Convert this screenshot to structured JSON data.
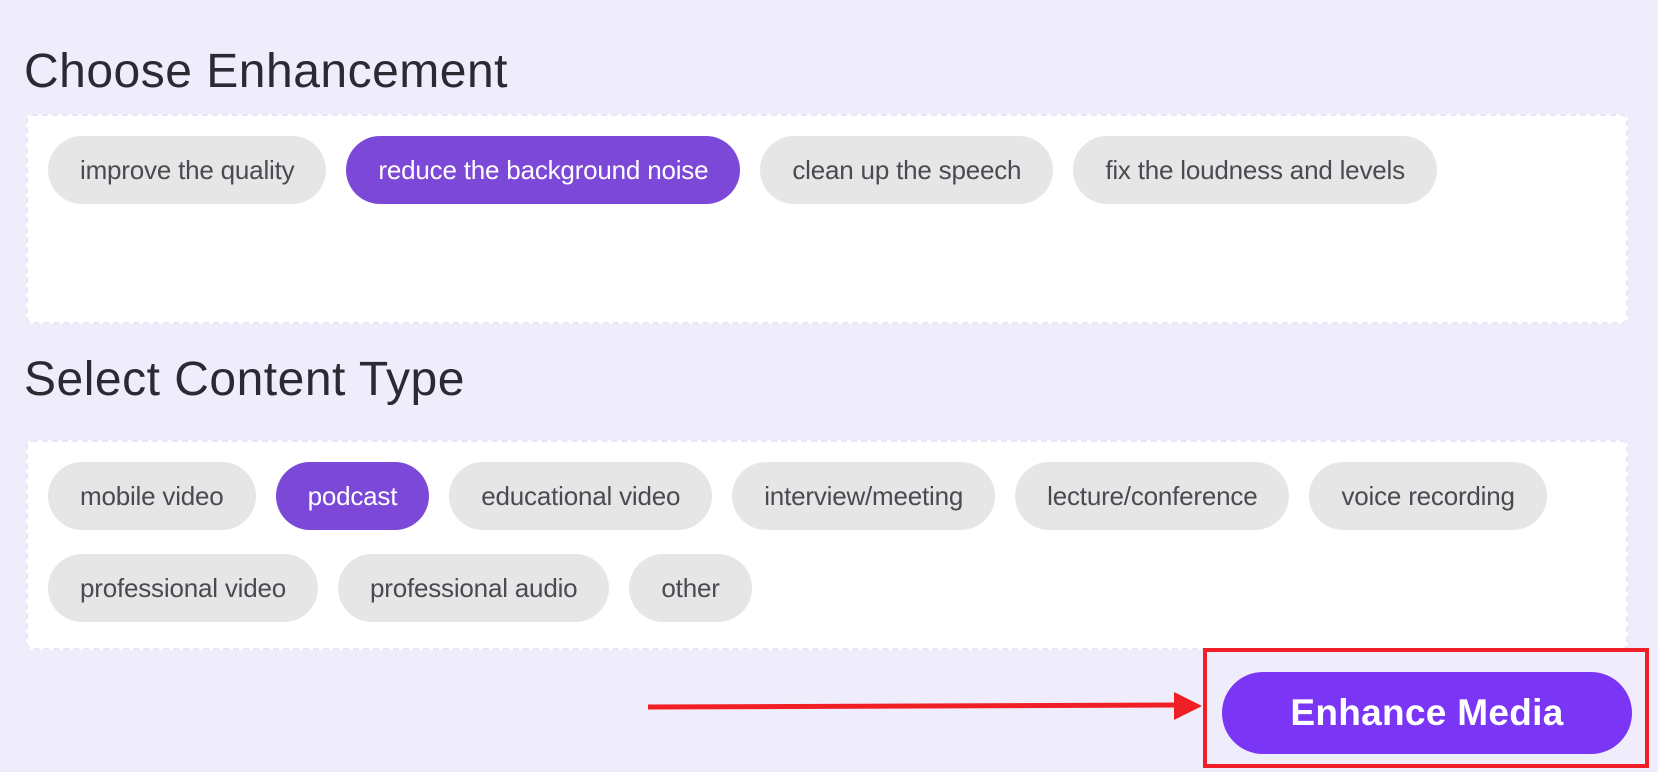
{
  "enhancement": {
    "title": "Choose Enhancement",
    "options": [
      {
        "label": "improve the quality",
        "selected": false
      },
      {
        "label": "reduce the background noise",
        "selected": true
      },
      {
        "label": "clean up the speech",
        "selected": false
      },
      {
        "label": "fix the loudness and levels",
        "selected": false
      }
    ]
  },
  "content_type": {
    "title": "Select Content Type",
    "options": [
      {
        "label": "mobile video",
        "selected": false
      },
      {
        "label": "podcast",
        "selected": true
      },
      {
        "label": "educational video",
        "selected": false
      },
      {
        "label": "interview/meeting",
        "selected": false
      },
      {
        "label": "lecture/conference",
        "selected": false
      },
      {
        "label": "voice recording",
        "selected": false
      },
      {
        "label": "professional video",
        "selected": false
      },
      {
        "label": "professional audio",
        "selected": false
      },
      {
        "label": "other",
        "selected": false
      }
    ]
  },
  "action": {
    "enhance_label": "Enhance Media"
  },
  "colors": {
    "accent": "#7c48d8",
    "button": "#7b35f5",
    "annotation": "#f01f25",
    "background": "#efedfb",
    "chip": "#e6e6e6"
  }
}
